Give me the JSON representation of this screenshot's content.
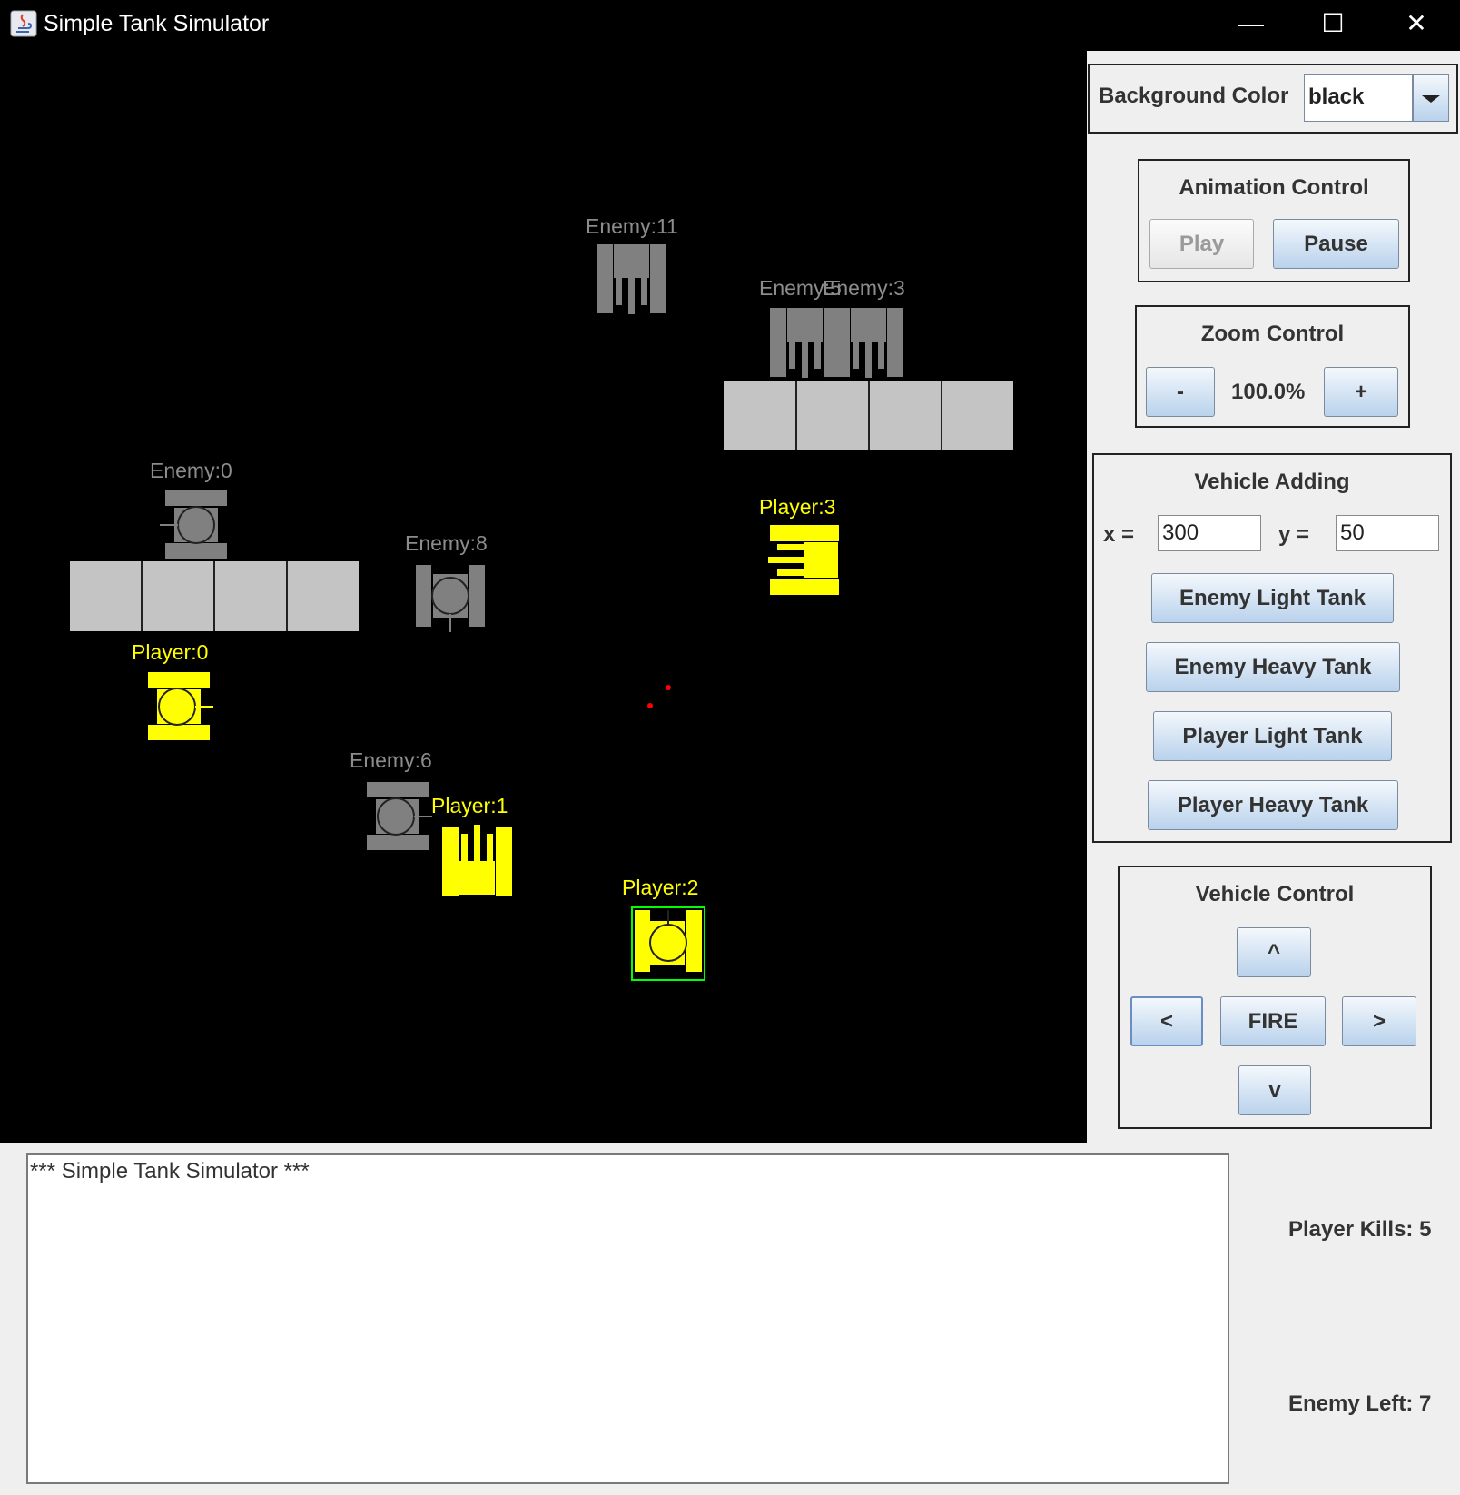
{
  "window": {
    "title": "Simple Tank Simulator",
    "minimize_glyph": "—",
    "maximize_glyph": "☐",
    "close_glyph": "✕"
  },
  "playfield": {
    "background": "#000000",
    "enemy_color": "#808080",
    "player_color": "#ffff00",
    "labels": {
      "enemy11": "Enemy:11",
      "enemy5": "Enemy:5",
      "enemy3": "Enemy:3",
      "enemy0": "Enemy:0",
      "enemy8": "Enemy:8",
      "enemy6": "Enemy:6",
      "player0": "Player:0",
      "player1": "Player:1",
      "player2": "Player:2",
      "player3": "Player:3"
    }
  },
  "panel": {
    "background_color": {
      "label": "Background Color",
      "value": "black"
    },
    "animation": {
      "title": "Animation Control",
      "play": "Play",
      "pause": "Pause"
    },
    "zoom": {
      "title": "Zoom Control",
      "minus": "-",
      "value": "100.0%",
      "plus": "+"
    },
    "adding": {
      "title": "Vehicle Adding",
      "x_label": "x =",
      "x_value": "300",
      "y_label": "y =",
      "y_value": "50",
      "enemy_light": "Enemy Light Tank",
      "enemy_heavy": "Enemy Heavy Tank",
      "player_light": "Player Light Tank",
      "player_heavy": "Player Heavy Tank"
    },
    "control": {
      "title": "Vehicle Control",
      "up": "^",
      "left": "<",
      "fire": "FIRE",
      "right": ">",
      "down": "v"
    }
  },
  "log": {
    "text": "*** Simple Tank Simulator ***"
  },
  "stats": {
    "player_kills": "Player Kills: 5",
    "enemy_left": "Enemy Left: 7"
  }
}
